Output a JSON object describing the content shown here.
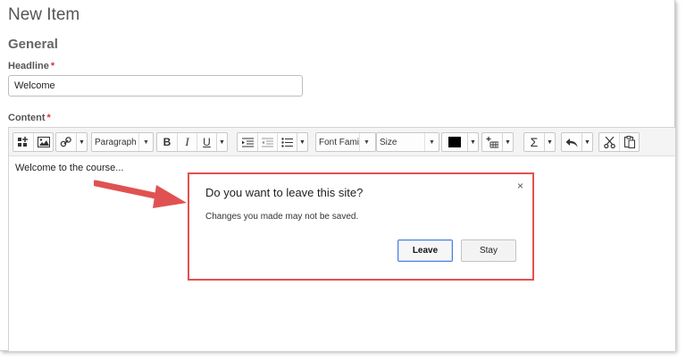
{
  "page": {
    "title": "New Item",
    "section": "General"
  },
  "headline": {
    "label": "Headline",
    "required_mark": "*",
    "value": "Welcome"
  },
  "content": {
    "label": "Content",
    "required_mark": "*",
    "body_text": "Welcome to the course..."
  },
  "toolbar": {
    "paragraph_select": "Paragraph",
    "font_family_select": "Font Family",
    "size_select": "Size",
    "icons": [
      "insert-stuff-icon",
      "insert-image-icon",
      "insert-link-icon",
      "bold-icon",
      "italic-icon",
      "underline-icon",
      "indent-icon",
      "outdent-icon",
      "bullet-list-icon",
      "text-color-icon",
      "insert-table-icon",
      "equation-icon",
      "undo-icon",
      "cut-icon",
      "paste-icon"
    ],
    "bold_glyph": "B",
    "italic_glyph": "I",
    "underline_glyph": "U",
    "sigma_glyph": "Σ"
  },
  "dialog": {
    "title": "Do you want to leave this site?",
    "message": "Changes you made may not be saved.",
    "leave_label": "Leave",
    "stay_label": "Stay",
    "close_glyph": "×"
  },
  "colors": {
    "highlight_border": "#e05252",
    "arrow": "#e05252",
    "primary_border": "#4a7ee0",
    "required": "#dd3333"
  }
}
